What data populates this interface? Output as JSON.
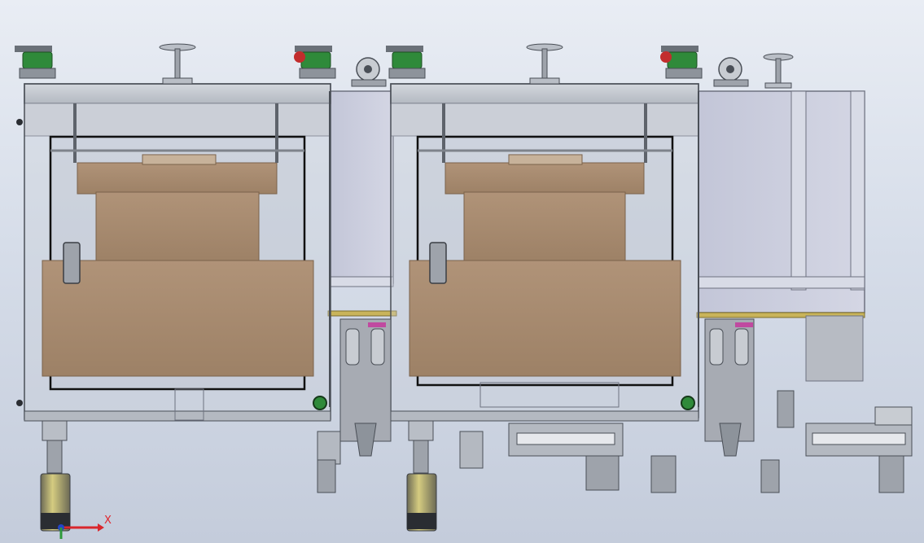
{
  "view": {
    "background_top": "#e9edf4",
    "background_bottom": "#c4ccdb",
    "colors": {
      "frame": "#b9bec6",
      "frame_dark": "#4a4f57",
      "panel": "#c9ccdc",
      "box": "#a98f74",
      "box_dark": "#8a7058",
      "green": "#2f8a3a",
      "rail": "#c9b45a",
      "motor_band": "#c8c06a"
    },
    "icons": [
      "triad-icon",
      "caster-wheel-icon",
      "leveling-foot-icon",
      "green-indicator-icon"
    ]
  },
  "triad": {
    "x_label": "X"
  }
}
